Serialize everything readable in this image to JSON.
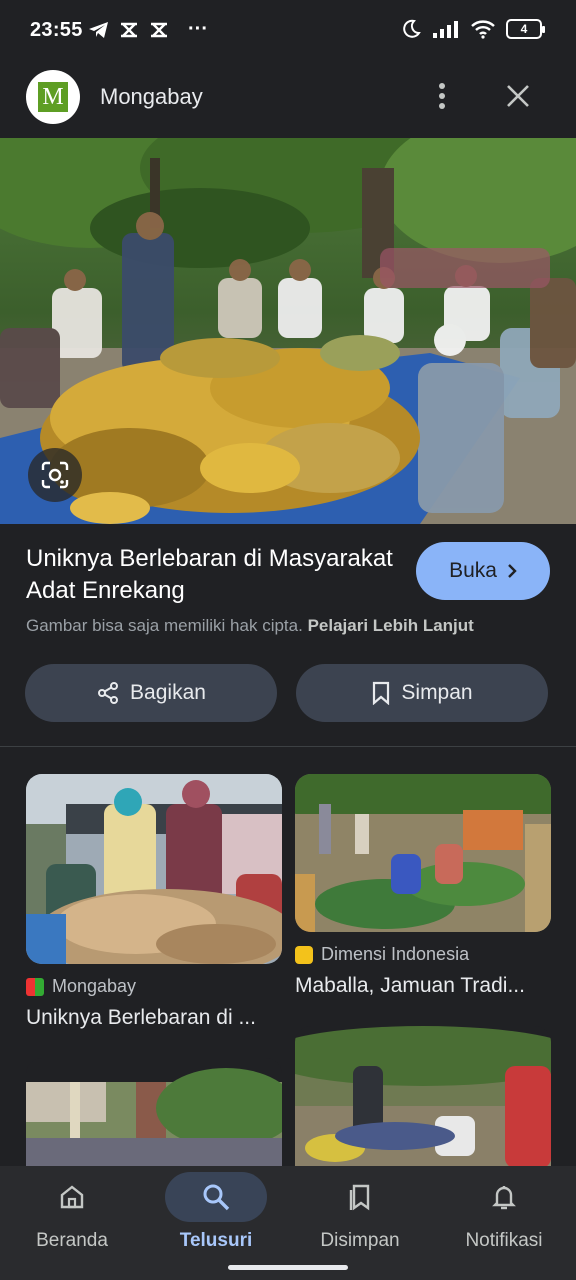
{
  "status_bar": {
    "time": "23:55",
    "more": "···",
    "battery": "4"
  },
  "header": {
    "logo_letter": "M",
    "site_name": "Mongabay",
    "icons": {
      "more": "more-vert-icon",
      "close": "close-icon"
    }
  },
  "result": {
    "title": "Uniknya Berlebaran di Masyarakat Adat Enrekang",
    "open_label": "Buka",
    "copyright_text": "Gambar bisa saja memiliki hak cipta.",
    "learn_more": "Pelajari Lebih Lanjut",
    "share_label": "Bagikan",
    "save_label": "Simpan"
  },
  "related": [
    {
      "source": "Mongabay",
      "title": "Uniknya Berlebaran di ..."
    },
    {
      "source": "Dimensi Indonesia",
      "title": "Maballa, Jamuan Tradi..."
    }
  ],
  "nav": {
    "items": [
      {
        "label": "Beranda",
        "icon": "home-icon"
      },
      {
        "label": "Telusuri",
        "icon": "search-icon"
      },
      {
        "label": "Disimpan",
        "icon": "bookmarks-icon"
      },
      {
        "label": "Notifikasi",
        "icon": "bell-icon"
      }
    ],
    "active": "Telusuri"
  },
  "colors": {
    "background": "#202124",
    "accent": "#8ab4f8",
    "nav_active": "#a8c7fa",
    "action_button": "#3c4350"
  }
}
